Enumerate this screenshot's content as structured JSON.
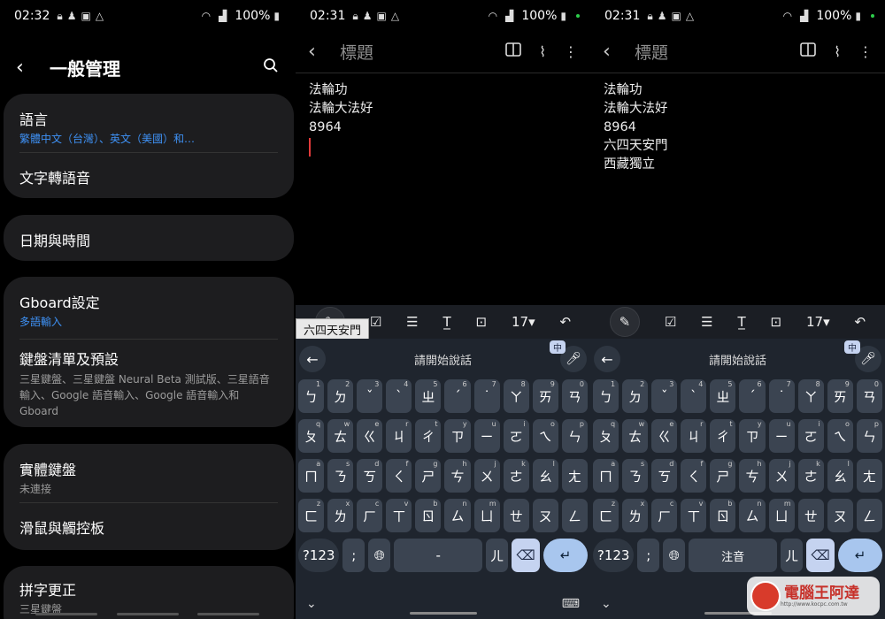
{
  "panel1": {
    "status": {
      "time": "02:32",
      "battery": "100%"
    },
    "header": {
      "title": "一般管理"
    },
    "cards": [
      {
        "items": [
          {
            "title": "語言",
            "subtitle": "繁體中文（台灣）、英文（美國）和…",
            "blue": true
          },
          {
            "title": "文字轉語音",
            "subtitle": ""
          }
        ]
      },
      {
        "items": [
          {
            "title": "日期與時間",
            "subtitle": ""
          }
        ]
      },
      {
        "items": [
          {
            "title": "Gboard設定",
            "subtitle": "多語輸入",
            "blue": true
          },
          {
            "title": "鍵盤清單及預設",
            "subtitle": "三星鍵盤、三星鍵盤 Neural Beta 測試版、三星語音輸入、Google 語音輸入、Google 語音輸入和 Gboard"
          }
        ]
      },
      {
        "items": [
          {
            "title": "實體鍵盤",
            "subtitle": "未連接"
          },
          {
            "title": "滑鼠與觸控板",
            "subtitle": ""
          }
        ]
      },
      {
        "items": [
          {
            "title": "拼字更正",
            "subtitle": "三星鍵盤"
          }
        ]
      }
    ]
  },
  "panel2": {
    "status": {
      "time": "02:31",
      "battery": "100%"
    },
    "note": {
      "title": "標題",
      "lines": [
        "法輪功",
        "法輪大法好",
        "8964"
      ]
    },
    "toolbar": {
      "font_size": "17"
    },
    "candidate": "六四天安門",
    "keyboard": {
      "hint": "請開始說話",
      "lang": "中",
      "space": "-",
      "num": "?123"
    }
  },
  "panel3": {
    "status": {
      "time": "02:31",
      "battery": "100%"
    },
    "note": {
      "title": "標題",
      "lines": [
        "法輪功",
        "法輪大法好",
        "8964",
        "六四天安門",
        "西藏獨立"
      ]
    },
    "toolbar": {
      "font_size": "17"
    },
    "keyboard": {
      "hint": "請開始說話",
      "lang": "中",
      "space": "注音",
      "num": "?123"
    }
  },
  "keyboard_rows": [
    [
      [
        "ㄅ",
        "1"
      ],
      [
        "ㄉ",
        "2"
      ],
      [
        "ˇ",
        "3"
      ],
      [
        "ˋ",
        "4"
      ],
      [
        "ㄓ",
        "5"
      ],
      [
        "ˊ",
        "6"
      ],
      [
        "˙",
        "7"
      ],
      [
        "ㄚ",
        "8"
      ],
      [
        "ㄞ",
        "9"
      ],
      [
        "ㄢ",
        "0"
      ]
    ],
    [
      [
        "ㄆ",
        "q"
      ],
      [
        "ㄊ",
        "w"
      ],
      [
        "ㄍ",
        "e"
      ],
      [
        "ㄐ",
        "r"
      ],
      [
        "ㄔ",
        "t"
      ],
      [
        "ㄗ",
        "y"
      ],
      [
        "ㄧ",
        "u"
      ],
      [
        "ㄛ",
        "i"
      ],
      [
        "ㄟ",
        "o"
      ],
      [
        "ㄣ",
        "p"
      ]
    ],
    [
      [
        "ㄇ",
        "a"
      ],
      [
        "ㄋ",
        "s"
      ],
      [
        "ㄎ",
        "d"
      ],
      [
        "ㄑ",
        "f"
      ],
      [
        "ㄕ",
        "g"
      ],
      [
        "ㄘ",
        "h"
      ],
      [
        "ㄨ",
        "j"
      ],
      [
        "ㄜ",
        "k"
      ],
      [
        "ㄠ",
        "l"
      ],
      [
        "ㄤ",
        ""
      ]
    ],
    [
      [
        "ㄈ",
        "z"
      ],
      [
        "ㄌ",
        "x"
      ],
      [
        "ㄏ",
        "c"
      ],
      [
        "ㄒ",
        "v"
      ],
      [
        "ㄖ",
        "b"
      ],
      [
        "ㄙ",
        "n"
      ],
      [
        "ㄩ",
        "m"
      ],
      [
        "ㄝ",
        ""
      ],
      [
        "ㄡ",
        ""
      ],
      [
        "ㄥ",
        ""
      ]
    ]
  ],
  "bottom_keys": {
    "semicolon": ";",
    "comma_hint": "，",
    "er": "ㄦ"
  },
  "watermark": {
    "text": "電腦王阿達",
    "url": "http://www.kocpc.com.tw"
  },
  "icons": {
    "back": "arrow-left-icon",
    "search": "search-icon",
    "book": "book-icon",
    "clip": "paperclip-icon",
    "more": "more-vert-icon"
  }
}
